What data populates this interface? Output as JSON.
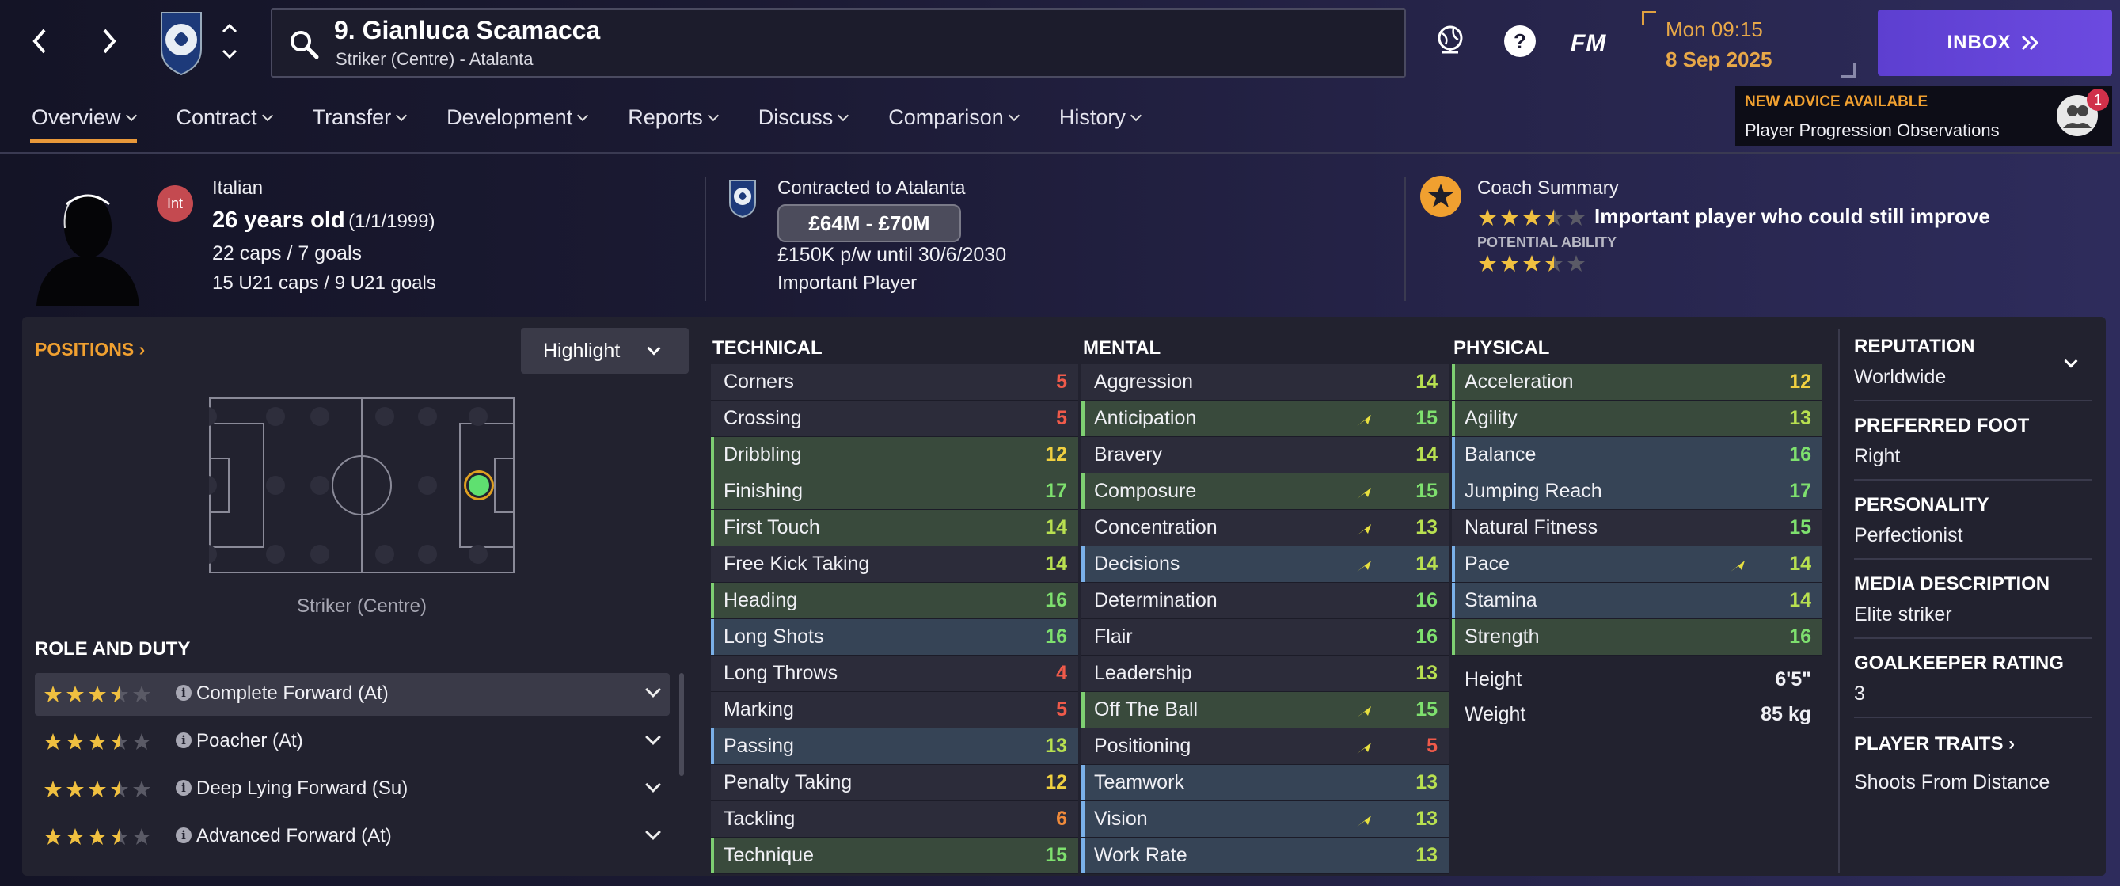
{
  "header": {
    "player_name": "9. Gianluca Scamacca",
    "player_subtitle": "Striker (Centre) - Atalanta",
    "fm_logo": "FM",
    "time": "Mon 09:15",
    "date": "8 Sep 2025",
    "inbox_label": "INBOX"
  },
  "tabs": [
    {
      "label": "Overview",
      "active": true
    },
    {
      "label": "Contract"
    },
    {
      "label": "Transfer"
    },
    {
      "label": "Development"
    },
    {
      "label": "Reports"
    },
    {
      "label": "Discuss"
    },
    {
      "label": "Comparison"
    },
    {
      "label": "History"
    }
  ],
  "advice": {
    "title": "NEW ADVICE AVAILABLE",
    "text": "Player Progression Observations",
    "count": "1"
  },
  "profile": {
    "nat_badge": "Int",
    "nationality": "Italian",
    "age": "26 years old",
    "dob": "(1/1/1999)",
    "caps": "22 caps / 7 goals",
    "u21": "15 U21 caps / 9 U21 goals"
  },
  "contract": {
    "title": "Contracted to Atalanta",
    "value": "£64M - £70M",
    "wage": "£150K p/w until 30/6/2030",
    "status": "Important Player"
  },
  "coach": {
    "title": "Coach Summary",
    "summary": "Important player who could still improve",
    "current_stars": 3.5,
    "potential_label": "POTENTIAL ABILITY",
    "potential_stars": 3.5
  },
  "positions": {
    "link": "POSITIONS",
    "highlight": "Highlight",
    "label": "Striker (Centre)"
  },
  "roles": {
    "heading": "ROLE AND DUTY",
    "items": [
      {
        "label": "Complete Forward (At)",
        "stars": 3.5,
        "selected": true
      },
      {
        "label": "Poacher (At)",
        "stars": 3.5
      },
      {
        "label": "Deep Lying Forward (Su)",
        "stars": 3.5
      },
      {
        "label": "Advanced Forward (At)",
        "stars": 3.5
      }
    ]
  },
  "technical": {
    "heading": "TECHNICAL",
    "rows": [
      {
        "name": "Corners",
        "value": "5",
        "bg": "n"
      },
      {
        "name": "Crossing",
        "value": "5",
        "bg": "n"
      },
      {
        "name": "Dribbling",
        "value": "12",
        "bg": "g"
      },
      {
        "name": "Finishing",
        "value": "17",
        "bg": "g"
      },
      {
        "name": "First Touch",
        "value": "14",
        "bg": "g"
      },
      {
        "name": "Free Kick Taking",
        "value": "14",
        "bg": "n"
      },
      {
        "name": "Heading",
        "value": "16",
        "bg": "g"
      },
      {
        "name": "Long Shots",
        "value": "16",
        "bg": "b"
      },
      {
        "name": "Long Throws",
        "value": "4",
        "bg": "n"
      },
      {
        "name": "Marking",
        "value": "5",
        "bg": "n"
      },
      {
        "name": "Passing",
        "value": "13",
        "bg": "b"
      },
      {
        "name": "Penalty Taking",
        "value": "12",
        "bg": "n"
      },
      {
        "name": "Tackling",
        "value": "6",
        "bg": "n"
      },
      {
        "name": "Technique",
        "value": "15",
        "bg": "g"
      }
    ]
  },
  "mental": {
    "heading": "MENTAL",
    "rows": [
      {
        "name": "Aggression",
        "value": "14",
        "bg": "n"
      },
      {
        "name": "Anticipation",
        "value": "15",
        "bg": "g",
        "arrow": true
      },
      {
        "name": "Bravery",
        "value": "14",
        "bg": "n"
      },
      {
        "name": "Composure",
        "value": "15",
        "bg": "g",
        "arrow": true
      },
      {
        "name": "Concentration",
        "value": "13",
        "bg": "n",
        "arrow": true
      },
      {
        "name": "Decisions",
        "value": "14",
        "bg": "b",
        "arrow": true
      },
      {
        "name": "Determination",
        "value": "16",
        "bg": "n"
      },
      {
        "name": "Flair",
        "value": "16",
        "bg": "n"
      },
      {
        "name": "Leadership",
        "value": "13",
        "bg": "n"
      },
      {
        "name": "Off The Ball",
        "value": "15",
        "bg": "g",
        "arrow": true
      },
      {
        "name": "Positioning",
        "value": "5",
        "bg": "n",
        "arrow": true
      },
      {
        "name": "Teamwork",
        "value": "13",
        "bg": "b"
      },
      {
        "name": "Vision",
        "value": "13",
        "bg": "b",
        "arrow": true
      },
      {
        "name": "Work Rate",
        "value": "13",
        "bg": "b"
      }
    ]
  },
  "physical": {
    "heading": "PHYSICAL",
    "rows": [
      {
        "name": "Acceleration",
        "value": "12",
        "bg": "g"
      },
      {
        "name": "Agility",
        "value": "13",
        "bg": "g"
      },
      {
        "name": "Balance",
        "value": "16",
        "bg": "b"
      },
      {
        "name": "Jumping Reach",
        "value": "17",
        "bg": "b"
      },
      {
        "name": "Natural Fitness",
        "value": "15",
        "bg": "n"
      },
      {
        "name": "Pace",
        "value": "14",
        "bg": "b",
        "arrow": true
      },
      {
        "name": "Stamina",
        "value": "14",
        "bg": "b"
      },
      {
        "name": "Strength",
        "value": "16",
        "bg": "g"
      }
    ],
    "height_label": "Height",
    "height": "6'5\"",
    "weight_label": "Weight",
    "weight": "85 kg"
  },
  "info": {
    "reputation_label": "REPUTATION",
    "reputation": "Worldwide",
    "foot_label": "PREFERRED FOOT",
    "foot": "Right",
    "personality_label": "PERSONALITY",
    "personality": "Perfectionist",
    "media_label": "MEDIA DESCRIPTION",
    "media": "Elite striker",
    "gk_label": "GOALKEEPER RATING",
    "gk": "3",
    "traits_label": "PLAYER TRAITS",
    "traits": "Shoots From Distance"
  },
  "colors": {
    "accent": "#e8983a",
    "inbox": "#6c4ae0",
    "good": "#7ee06e",
    "bad": "#ef5a4a"
  }
}
